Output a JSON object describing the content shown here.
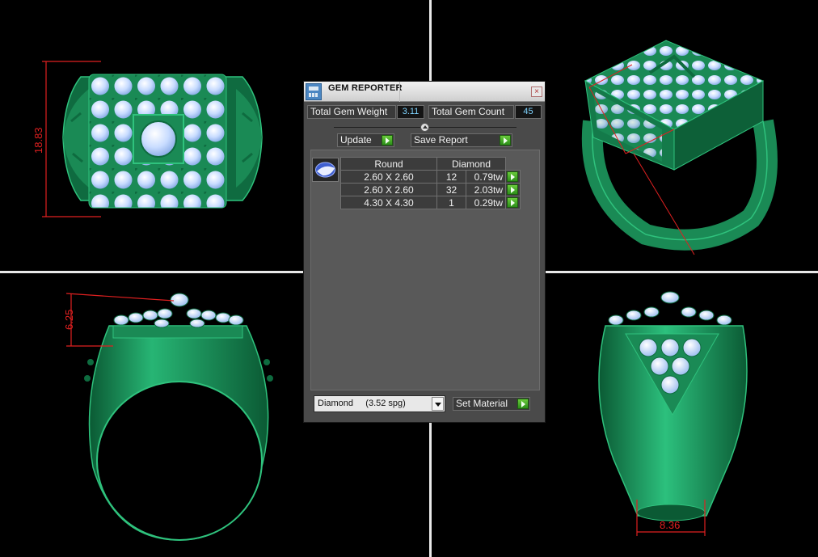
{
  "panel": {
    "title": "GEM REPORTER",
    "close_glyph": "×",
    "icon": "gem-report-icon"
  },
  "stats": {
    "total_weight_label": "Total Gem Weight",
    "total_weight_value": "3.11",
    "total_count_label": "Total Gem Count",
    "total_count_value": "45"
  },
  "buttons": {
    "update": "Update",
    "save_report": "Save Report",
    "set_material": "Set Material"
  },
  "report": {
    "thumbnail_icon": "round-gem-icon",
    "headers": {
      "shape": "Round",
      "material": "Diamond"
    },
    "rows": [
      {
        "size": "2.60 X 2.60",
        "count": "12",
        "weight": "0.79tw"
      },
      {
        "size": "2.60 X 2.60",
        "count": "32",
        "weight": "2.03tw"
      },
      {
        "size": "4.30 X 4.30",
        "count": "1",
        "weight": "0.29tw"
      }
    ]
  },
  "material": {
    "selected": "Diamond     (3.52 spg)"
  },
  "viewports": {
    "top_dimension": "18.83",
    "front_dimension": "6.25",
    "side_dimension": "8.36"
  },
  "colors": {
    "ring_green": "#1f9e63",
    "gem_blue": "#c8dcff",
    "dimension_red": "#e02020",
    "panel_bg": "#4a4a4a"
  }
}
